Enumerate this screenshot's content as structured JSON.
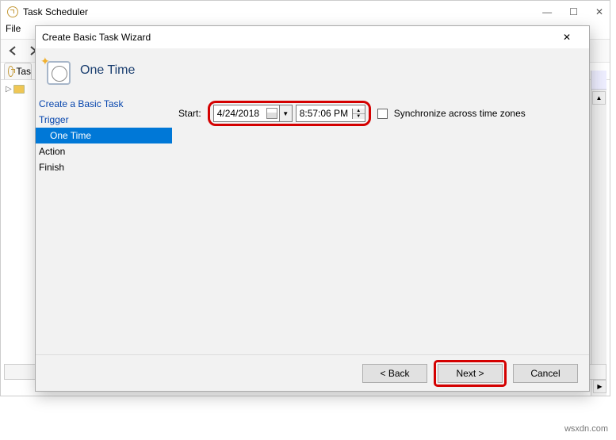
{
  "main_window": {
    "title": "Task Scheduler",
    "menu_file": "File",
    "tab_partial": "Tas"
  },
  "actions_pane_scroll_up": "▲",
  "actions_pane_scroll_right": "▶",
  "wizard": {
    "title": "Create Basic Task Wizard",
    "heading": "One Time",
    "nav": {
      "create": "Create a Basic Task",
      "trigger": "Trigger",
      "one_time": "One Time",
      "action": "Action",
      "finish": "Finish"
    },
    "content": {
      "start_label": "Start:",
      "date_value": "4/24/2018",
      "time_value": "8:57:06 PM",
      "sync_label": "Synchronize across time zones"
    },
    "buttons": {
      "back": "< Back",
      "next": "Next >",
      "cancel": "Cancel"
    }
  },
  "website": "wsxdn.com"
}
